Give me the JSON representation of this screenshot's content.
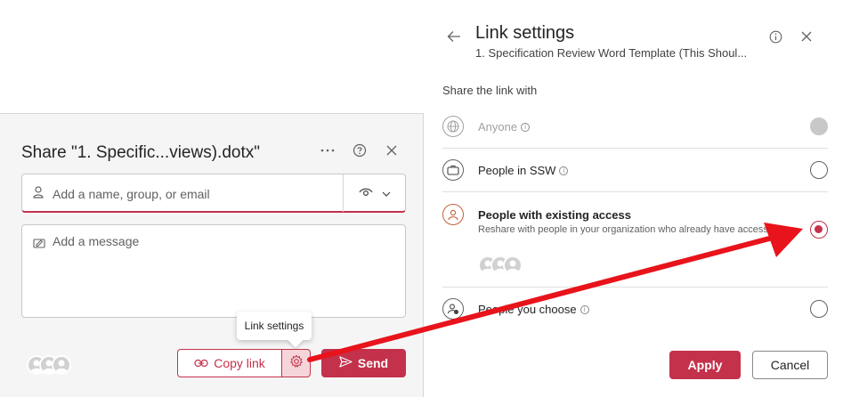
{
  "share_dialog": {
    "title": "Share \"1. Specific...views).dotx\"",
    "recipient_placeholder": "Add a name, group, or email",
    "message_placeholder": "Add a message",
    "tooltip": "Link settings",
    "copy_link_label": "Copy link",
    "send_label": "Send",
    "more_icon": "ellipsis-icon",
    "help_icon": "question-icon",
    "close_icon": "close-icon"
  },
  "link_settings": {
    "title": "Link settings",
    "subtitle": "1. Specification Review Word Template (This Shoul...",
    "section_label": "Share the link with",
    "options": [
      {
        "label": "Anyone",
        "state": "disabled",
        "icon": "globe-icon"
      },
      {
        "label": "People in SSW",
        "state": "unchecked",
        "icon": "briefcase-icon"
      },
      {
        "label": "People with existing access",
        "description": "Reshare with people in your organization who already have access.",
        "state": "checked",
        "icon": "person-icon"
      },
      {
        "label": "People you choose",
        "state": "unchecked",
        "icon": "person-settings-icon"
      }
    ],
    "apply_label": "Apply",
    "cancel_label": "Cancel"
  },
  "colors": {
    "accent": "#c4314b",
    "arrow": "#e8131b"
  }
}
